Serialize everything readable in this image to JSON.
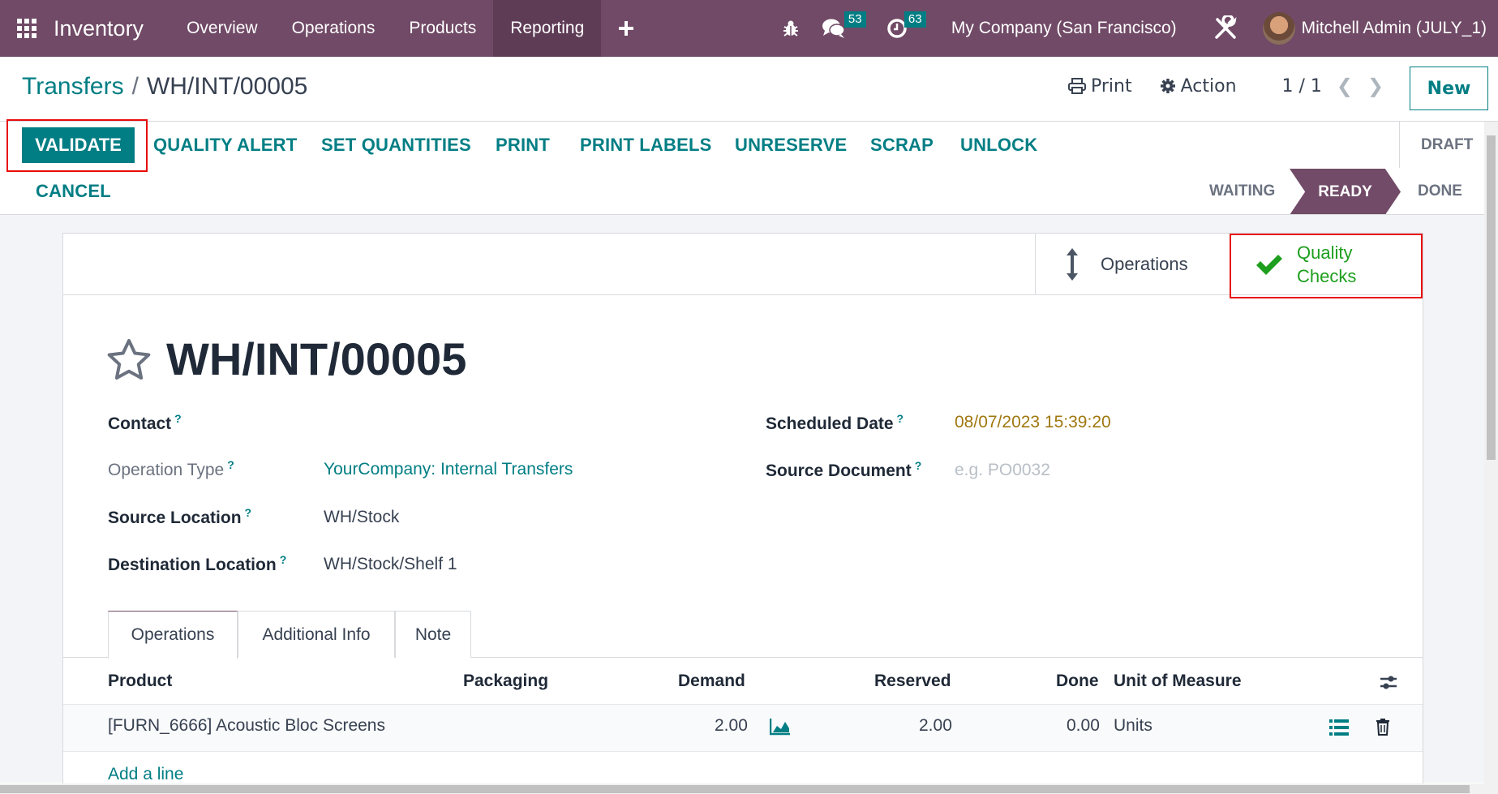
{
  "navbar": {
    "app_name": "Inventory",
    "menu": [
      "Overview",
      "Operations",
      "Products",
      "Reporting"
    ],
    "active_menu": "Reporting",
    "messages_count": "53",
    "activities_count": "63",
    "company": "My Company (San Francisco)",
    "user": "Mitchell Admin (JULY_1)",
    "bg_color": "#704a66"
  },
  "breadcrumb": {
    "parent": "Transfers",
    "separator": "/",
    "current": "WH/INT/00005"
  },
  "control_panel": {
    "print_label": "Print",
    "action_label": "Action",
    "pager": "1 / 1",
    "new_label": "New"
  },
  "actions": {
    "validate": "VALIDATE",
    "quality_alert": "QUALITY ALERT",
    "set_quantities": "SET QUANTITIES",
    "print": "PRINT",
    "print_labels": "PRINT LABELS",
    "unreserve": "UNRESERVE",
    "scrap": "SCRAP",
    "unlock": "UNLOCK",
    "cancel": "CANCEL"
  },
  "statusbar": {
    "states": [
      "DRAFT",
      "WAITING",
      "READY",
      "DONE"
    ],
    "current": "READY",
    "accent": "#714b67"
  },
  "smart_buttons": {
    "operations": "Operations",
    "quality_checks_line1": "Quality",
    "quality_checks_line2": "Checks",
    "quality_color": "#1e9e1e"
  },
  "record": {
    "title": "WH/INT/00005",
    "fields": {
      "contact": {
        "label": "Contact",
        "value": ""
      },
      "operation_type": {
        "label": "Operation Type",
        "value": "YourCompany: Internal Transfers"
      },
      "source_location": {
        "label": "Source Location",
        "value": "WH/Stock"
      },
      "destination_location": {
        "label": "Destination Location",
        "value": "WH/Stock/Shelf 1"
      },
      "scheduled_date": {
        "label": "Scheduled Date",
        "value": "08/07/2023 15:39:20"
      },
      "source_document": {
        "label": "Source Document",
        "placeholder": "e.g. PO0032"
      }
    },
    "help_mark": "?"
  },
  "tabs": [
    "Operations",
    "Additional Info",
    "Note"
  ],
  "active_tab": "Operations",
  "table": {
    "headers": [
      "Product",
      "Packaging",
      "Demand",
      "Reserved",
      "Done",
      "Unit of Measure"
    ],
    "rows": [
      {
        "product": "[FURN_6666] Acoustic Bloc Screens",
        "packaging": "",
        "demand": "2.00",
        "reserved": "2.00",
        "done": "0.00",
        "uom": "Units"
      }
    ],
    "add_line": "Add a line"
  },
  "brand_color": "#017e84"
}
